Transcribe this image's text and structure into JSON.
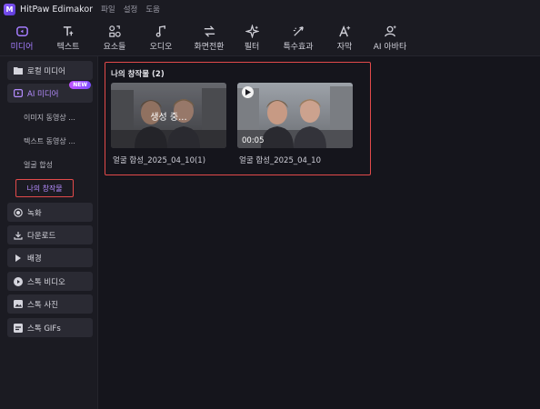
{
  "app": {
    "title": "HitPaw Edimakor",
    "logo_glyph": "M"
  },
  "menu": [
    "파일",
    "설정",
    "도움"
  ],
  "toolbar": {
    "active_color": "#a57dff",
    "tools": [
      {
        "label": "미디어",
        "icon": "media-icon"
      },
      {
        "label": "텍스트",
        "icon": "text-icon"
      },
      {
        "label": "요소들",
        "icon": "elements-icon"
      },
      {
        "label": "오디오",
        "icon": "audio-icon"
      },
      {
        "label": "화면전환",
        "icon": "transition-icon"
      },
      {
        "label": "필터",
        "icon": "filter-icon"
      },
      {
        "label": "특수효과",
        "icon": "effects-icon"
      },
      {
        "label": "자막",
        "icon": "subtitle-icon"
      },
      {
        "label": "AI 아바타",
        "icon": "avatar-icon"
      }
    ]
  },
  "sidebar": {
    "local_media": "로컬 미디어",
    "ai_media": "AI 미디어",
    "new_badge": "NEW",
    "sub_items": [
      "이미지 동영상 ...",
      "텍스트 동영상 ...",
      "얼굴 합성",
      "나의 창작물"
    ],
    "items": [
      "녹화",
      "다운로드",
      "배경",
      "스톡 비디오",
      "스톡 사진",
      "스톡 GIFs"
    ]
  },
  "main": {
    "panel_title": "나의 창작물 (2)",
    "cards": [
      {
        "overlay": "생성 중...",
        "caption": "얼굴 합성_2025_04_10(1)"
      },
      {
        "duration": "00:05",
        "caption": "얼굴 합성_2025_04_10"
      }
    ]
  },
  "colors": {
    "highlight_border": "#e24a4a",
    "accent": "#a57dff"
  }
}
